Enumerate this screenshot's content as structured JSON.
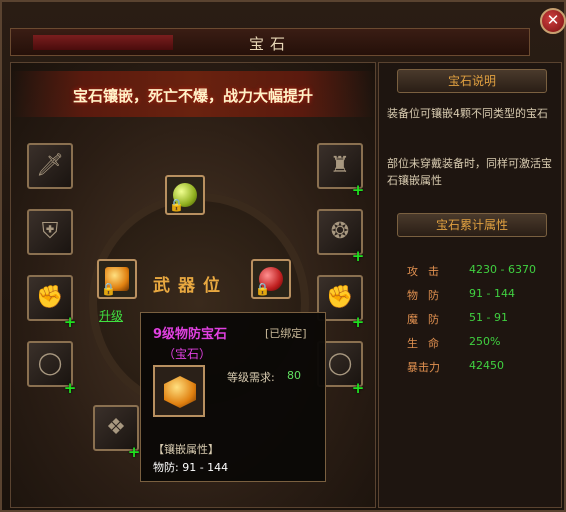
{
  "window": {
    "title": "宝石",
    "close_label": "✕"
  },
  "banner": {
    "text": "宝石镶嵌，死亡不爆，战力大幅提升"
  },
  "center": {
    "label": "武器位",
    "upgrade_link": "升级"
  },
  "tooltip": {
    "name": "9级物防宝石",
    "bound": "[已绑定]",
    "type": "（宝石）",
    "level_req_label": "等级需求:",
    "level_req_value": "80",
    "attr_title": "【镶嵌属性】",
    "attr_line": "物防: 91 - 144"
  },
  "info": {
    "head": "宝石说明",
    "line1": "装备位可镶嵌4颗不同类型的宝石",
    "line2": "部位未穿戴装备时，同样可激活宝石镶嵌属性"
  },
  "stats": {
    "head": "宝石累计属性",
    "rows": [
      {
        "label": "攻击",
        "value": "4230 - 6370"
      },
      {
        "label": "物防",
        "value": "91 - 144"
      },
      {
        "label": "魔防",
        "value": "51 - 91"
      },
      {
        "label": "生命",
        "value": "250%"
      },
      {
        "label": "暴击力",
        "value": "42450"
      }
    ]
  },
  "colors": {
    "accent": "#e0a040",
    "green": "#40d040",
    "purple": "#e040e0"
  }
}
